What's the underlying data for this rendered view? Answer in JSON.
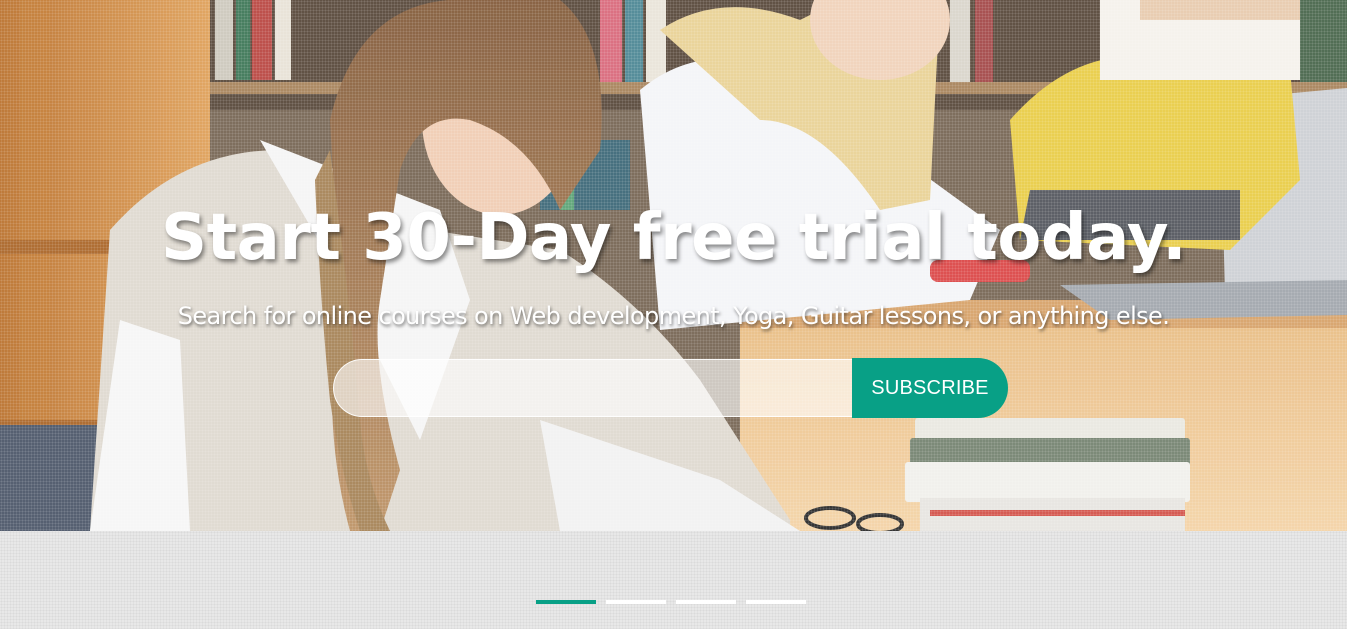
{
  "hero": {
    "title": "Start 30-Day free trial today.",
    "subtitle": "Search for online courses on Web development, Yoga, Guitar lessons, or anything else."
  },
  "subscribe": {
    "input_value": "",
    "input_placeholder": "",
    "button_label": "SUBSCRIBE"
  },
  "carousel": {
    "slides": [
      {
        "active": true
      },
      {
        "active": false
      },
      {
        "active": false
      },
      {
        "active": false
      }
    ]
  },
  "colors": {
    "accent": "#08a086",
    "indicator_inactive": "#ffffff",
    "page_background": "#e8e8e8"
  }
}
